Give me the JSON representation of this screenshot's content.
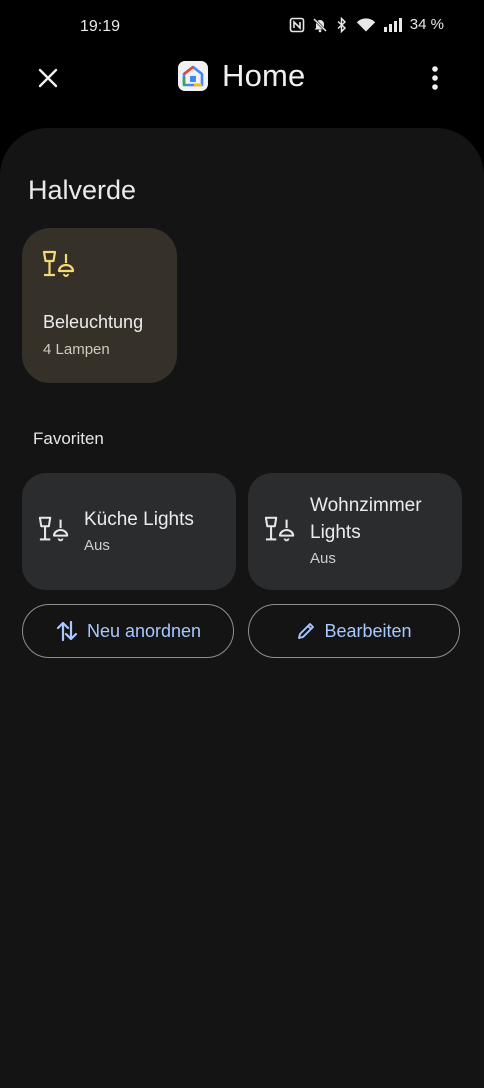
{
  "status_bar": {
    "time": "19:19",
    "battery": "34 %",
    "icons": [
      "nfc-icon",
      "mute-icon",
      "bluetooth-icon",
      "wifi-icon",
      "signal-icon"
    ]
  },
  "top_bar": {
    "title": "Home",
    "close_icon": "close-icon",
    "menu_icon": "more-vert-icon"
  },
  "home_name": "Halverde",
  "group_card": {
    "name": "Beleuchtung",
    "subtitle": "4 Lampen",
    "icon": "lamp-icon",
    "accent": "#f5d877"
  },
  "favorites": {
    "title": "Favoriten",
    "items": [
      {
        "name": "Küche Lights",
        "state": "Aus",
        "icon": "lamp-icon"
      },
      {
        "name": "Wohnzimmer Lights",
        "state": "Aus",
        "icon": "lamp-icon"
      }
    ]
  },
  "actions": {
    "rearrange_label": "Neu anordnen",
    "edit_label": "Bearbeiten",
    "accent": "#a8c8ff"
  }
}
